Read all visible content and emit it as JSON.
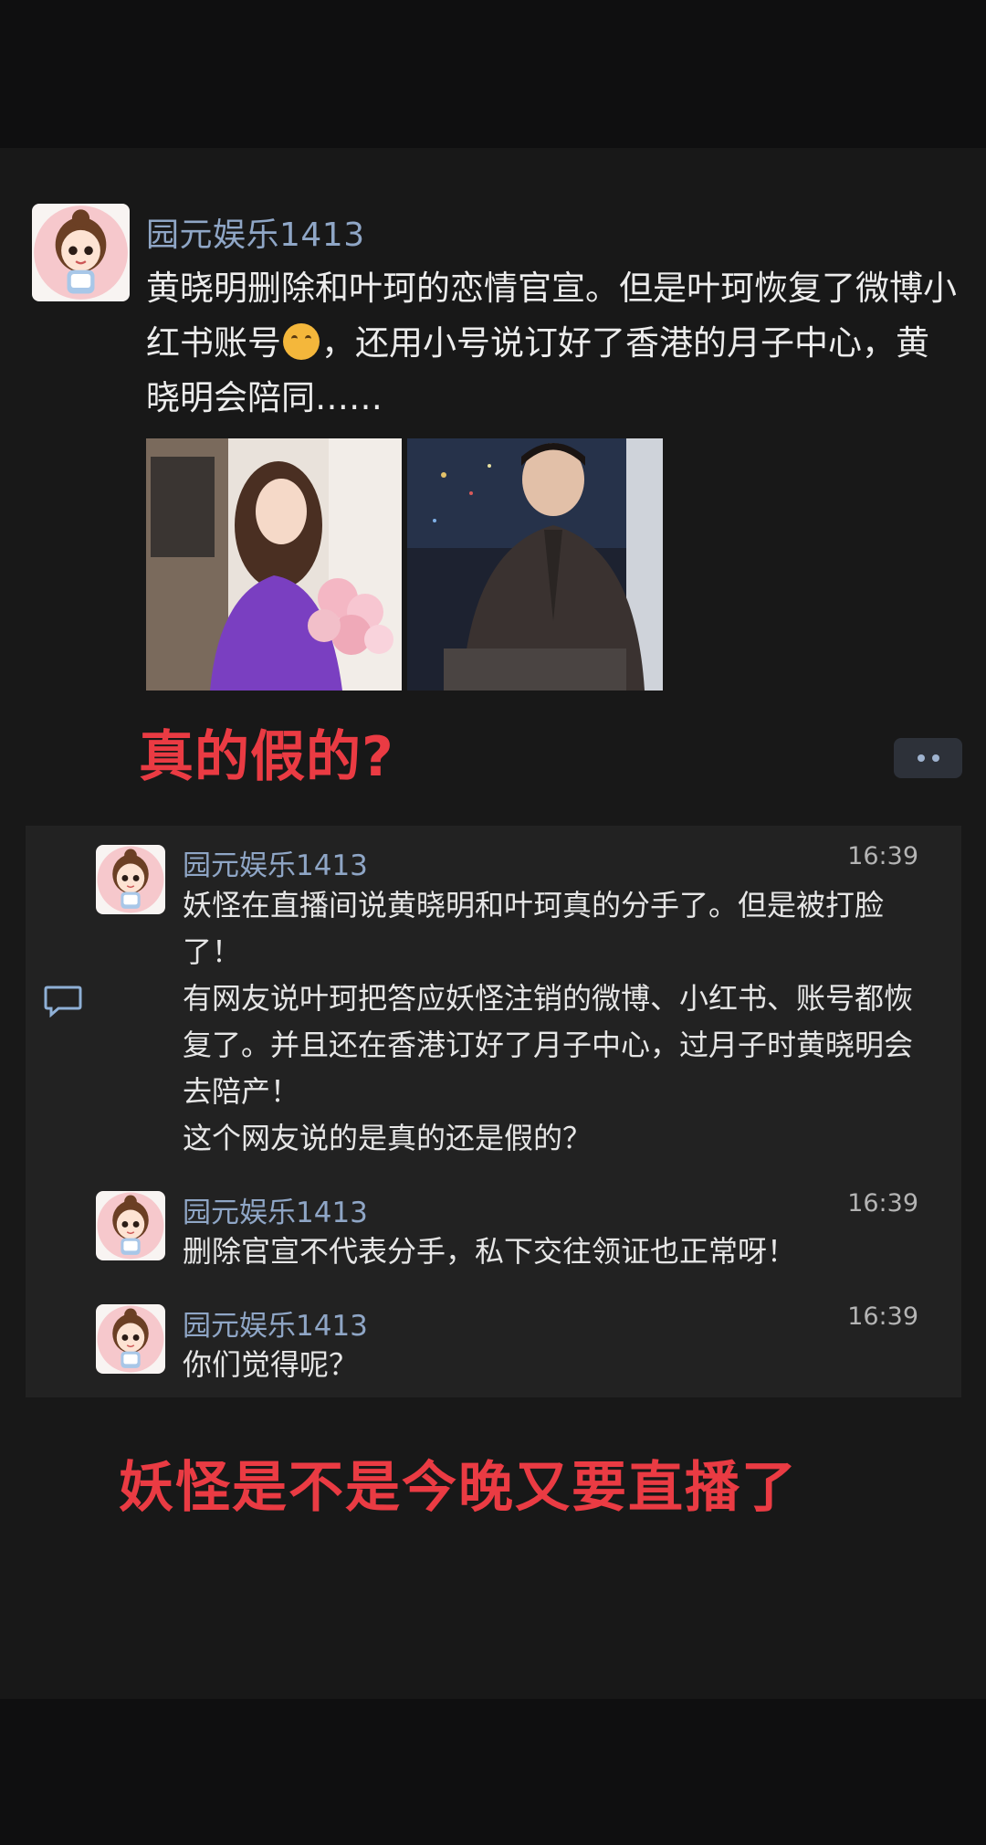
{
  "post": {
    "author": "园元娱乐1413",
    "text_part1": "黄晓明删除和叶珂的恋情官宣。但是叶珂恢复了微博小红书账号",
    "text_part2": "，还用小号说订好了香港的月子中心，黄晓明会陪同……",
    "emoji": "laughing-crying-emoji"
  },
  "overlay_question": "真的假的?",
  "overlay_bottom": "妖怪是不是今晚又要直播了",
  "comments": [
    {
      "author": "园元娱乐1413",
      "time": "16:39",
      "text": "妖怪在直播间说黄晓明和叶珂真的分手了。但是被打脸了！\n有网友说叶珂把答应妖怪注销的微博、小红书、账号都恢复了。并且还在香港订好了月子中心，过月子时黄晓明会去陪产！\n这个网友说的是真的还是假的？"
    },
    {
      "author": "园元娱乐1413",
      "time": "16:39",
      "text": "删除官宣不代表分手，私下交往领证也正常呀！"
    },
    {
      "author": "园元娱乐1413",
      "time": "16:39",
      "text": "你们觉得呢？"
    }
  ],
  "colors": {
    "name": "#8fa6c6",
    "overlay_red": "#ea3b43",
    "panel": "#222222",
    "background": "#181818"
  }
}
